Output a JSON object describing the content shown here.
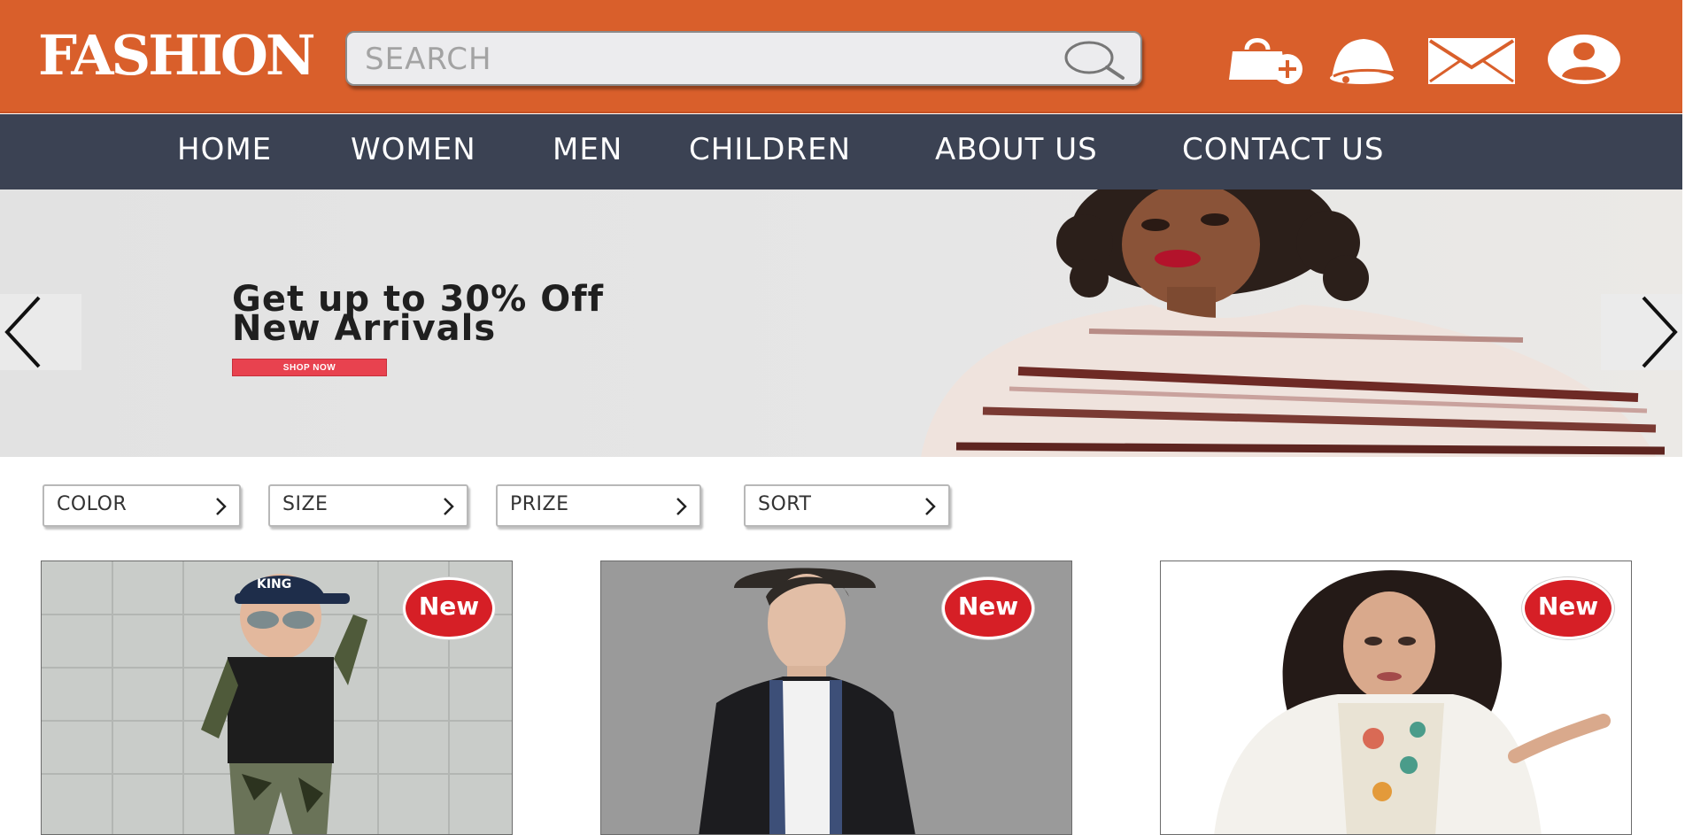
{
  "header": {
    "logo": "FASHION",
    "search": {
      "placeholder": "SEARCH"
    },
    "icons": [
      "shopping-bag-add-icon",
      "bell-icon",
      "mail-icon",
      "user-profile-icon"
    ]
  },
  "nav": {
    "items": [
      "HOME",
      "WOMEN",
      "MEN",
      "CHILDREN",
      "ABOUT US",
      "CONTACT US"
    ]
  },
  "banner": {
    "headline_line1": "Get up to 30% Off",
    "headline_line2": "New Arrivals",
    "cta": "SHOP NOW"
  },
  "filters": [
    {
      "label": "COLOR"
    },
    {
      "label": "SIZE"
    },
    {
      "label": "PRIZE"
    },
    {
      "label": "SORT"
    }
  ],
  "products": [
    {
      "badge": "New"
    },
    {
      "badge": "New"
    },
    {
      "badge": "New"
    }
  ],
  "colors": {
    "header_bg": "#d95f2b",
    "nav_bg": "#3b4253",
    "badge": "#d61f26",
    "cta": "#e8424f"
  }
}
